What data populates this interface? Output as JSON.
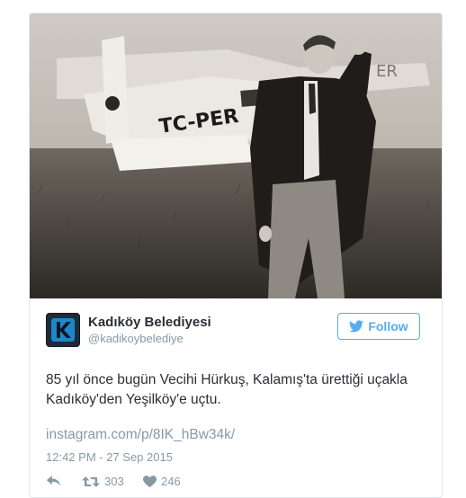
{
  "tweet": {
    "display_name": "Kadıköy Belediyesi",
    "handle": "@kadikoybelediye",
    "follow_label": "Follow",
    "text_line1": "85 yıl önce bugün Vecihi Hürkuş, Kalamış'ta ürettiği uçakla",
    "text_line2": "Kadıköy'den Yeşilköy'e uçtu.",
    "link": "instagram.com/p/8IK_hBw34k/",
    "timestamp": "12:42 PM - 27 Sep 2015",
    "retweets": "303",
    "likes": "246",
    "aircraft_marking": "TC-PER"
  },
  "icons": {
    "avatar": "kadikoy-logo-k",
    "follow": "twitter-bird-icon",
    "reply": "reply-icon",
    "retweet": "retweet-icon",
    "like": "heart-icon"
  },
  "colors": {
    "accent": "#55acee",
    "text": "#292f33",
    "muted": "#8899a6",
    "border": "#e1e8ed",
    "avatar_bg": "#1d2b3a",
    "avatar_k": "#1d88c8"
  }
}
